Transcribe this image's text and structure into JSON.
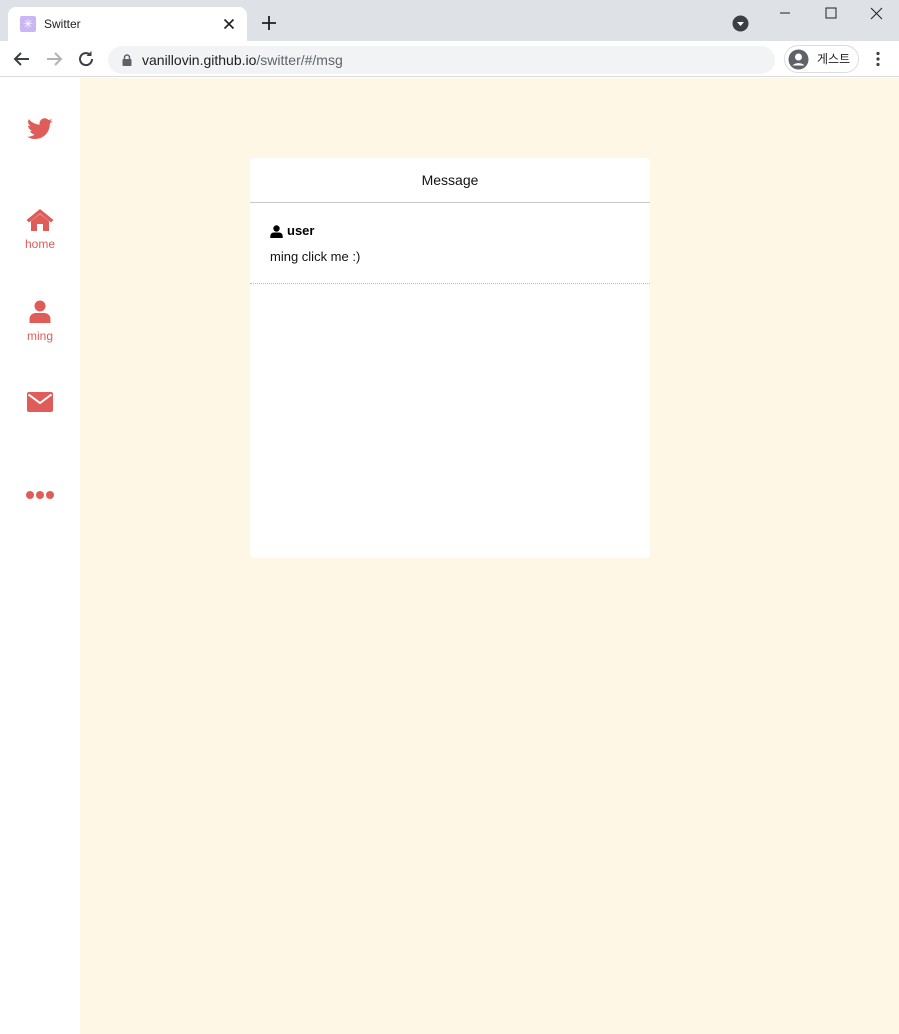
{
  "browser": {
    "tab_title": "Switter",
    "url_host": "vanillovin.github.io",
    "url_path": "/switter/#/msg",
    "profile_label": "게스트"
  },
  "sidebar": {
    "items": [
      {
        "icon": "twitter-bird-icon",
        "label": ""
      },
      {
        "icon": "home-icon",
        "label": "home"
      },
      {
        "icon": "user-icon",
        "label": "ming"
      },
      {
        "icon": "envelope-icon",
        "label": ""
      },
      {
        "icon": "more-dots-icon",
        "label": ""
      }
    ]
  },
  "message_panel": {
    "title": "Message",
    "messages": [
      {
        "user": "user",
        "text": "ming click me :)"
      }
    ]
  },
  "colors": {
    "accent": "#e05c58",
    "page_background": "#fef7e6",
    "card_background": "#ffffff"
  }
}
